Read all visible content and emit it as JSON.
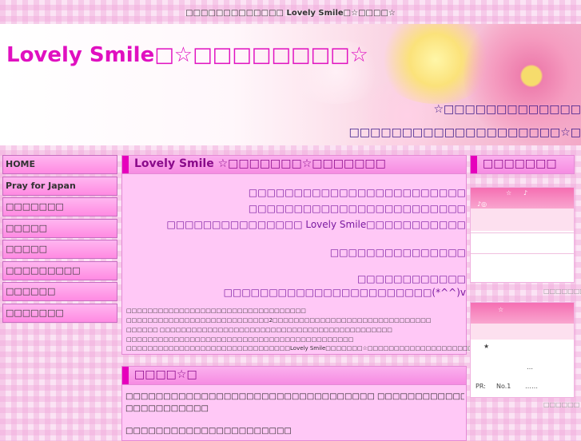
{
  "topbar": {
    "text": "□□□□□□□□□□□□□ Lovely Smile□☆□□□□☆"
  },
  "header": {
    "title": "Lovely Smile□☆□□□□□□□□☆",
    "tagline_1": "☆□□□□□□□□□□□□□",
    "tagline_2": "□□□□□□□□□□□□□□□□□□□□☆□"
  },
  "nav": {
    "items": [
      {
        "label": "HOME"
      },
      {
        "label": "Pray for Japan"
      },
      {
        "label": "□□□□□□□"
      },
      {
        "label": "□□□□□"
      },
      {
        "label": "□□□□□"
      },
      {
        "label": "□□□□□□□□□"
      },
      {
        "label": "□□□□□□"
      },
      {
        "label": "□□□□□□□"
      }
    ]
  },
  "intro": {
    "heading": "Lovely Smile ☆□□□□□□□☆□□□□□□□",
    "lines": [
      "□□□□□□□□□□□□□□□□□□□□□□□□",
      "□□□□□□□□□□□□□□□□□□□□□□□□",
      "□□□□□□□□□□□□□□□ Lovely Smile□□□□□□□□□□□",
      "□□□□□□□□□□□□□□□",
      "□□□□□□□□□□□□ ",
      "□□□□□□□□□□□□□□□□□□□□□□□(*^^)v"
    ],
    "small_lines": [
      "□□□□□□□□□□□□□□□□□□□□□□□□□□□□□□□□□□",
      "□□□□□□□□□□□□□□□□□□□□□□□□□□□2□□□□□□□□□□□□□□□□□□□□□□□□□□□□□□",
      "□□□□□□ □□□□□□□□□□□□□□□□□□□□□□□□□□□□□□□□□□□□□□□□□□□□",
      "□□□□□□□□□□□□□□□□□□□□□□□□□□□□□□□□□□□□□□□□□□□",
      "□□□□□□□□□□□□□□□□□□□□□□□□□□□□□□□Lovely Smile□□□□□□□☆□□□□□□□□□□□□□□□□□□□□□□□(_^_)_"
    ]
  },
  "news": {
    "heading": "□□□□☆□",
    "lines": [
      "□□□□□□□□□□□□□□□□□□□□□□□□□□□□□□□□□ □□□□□□□□□□□□□□□□□□□□□□□□□ □□□□□□□□□□□□□□□□□□□□□□□□",
      "□□□□□□□□□□□",
      "□□□□□□□□□□□□□□□□□□□□□□"
    ]
  },
  "sidebar_right": {
    "heading": "□□□□□□□",
    "widget1": {
      "star": "☆",
      "note": "♪",
      "sub": "♪◎",
      "footer": "□□□□□□□□"
    },
    "widget2": {
      "star": "☆",
      "bullet": "★",
      "dots": "…",
      "dots2": "…",
      "pr_label": "PR:",
      "pr_item": "No.1",
      "pr_dots": "……",
      "footer": "□□□□□□"
    }
  },
  "colors": {
    "accent": "#e600bc",
    "title": "#e010c0",
    "nav_bg": "#ff9fe8",
    "heading_text": "#8a0a8a"
  }
}
